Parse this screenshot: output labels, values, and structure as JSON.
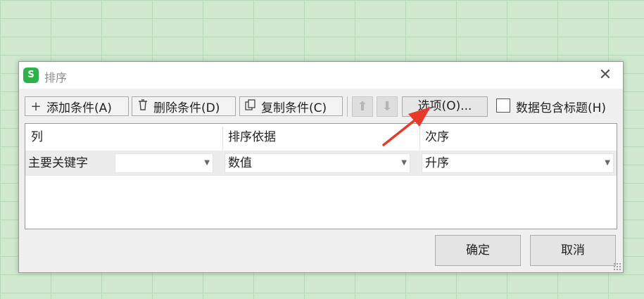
{
  "dialog": {
    "title": "排序",
    "app_icon_text": "S"
  },
  "toolbar": {
    "add_label": "添加条件(A)",
    "delete_label": "删除条件(D)",
    "copy_label": "复制条件(C)",
    "options_label": "选项(O)...",
    "header_checkbox_label": "数据包含标题(H)",
    "header_checkbox_checked": false
  },
  "table": {
    "headers": [
      "列",
      "排序依据",
      "次序"
    ],
    "row": {
      "label": "主要关键字",
      "column_value": "",
      "sort_by": "数值",
      "order": "升序"
    }
  },
  "buttons": {
    "ok": "确定",
    "cancel": "取消"
  },
  "colors": {
    "accent_icon": "#2db24a",
    "annotation_arrow": "#e8392a"
  }
}
